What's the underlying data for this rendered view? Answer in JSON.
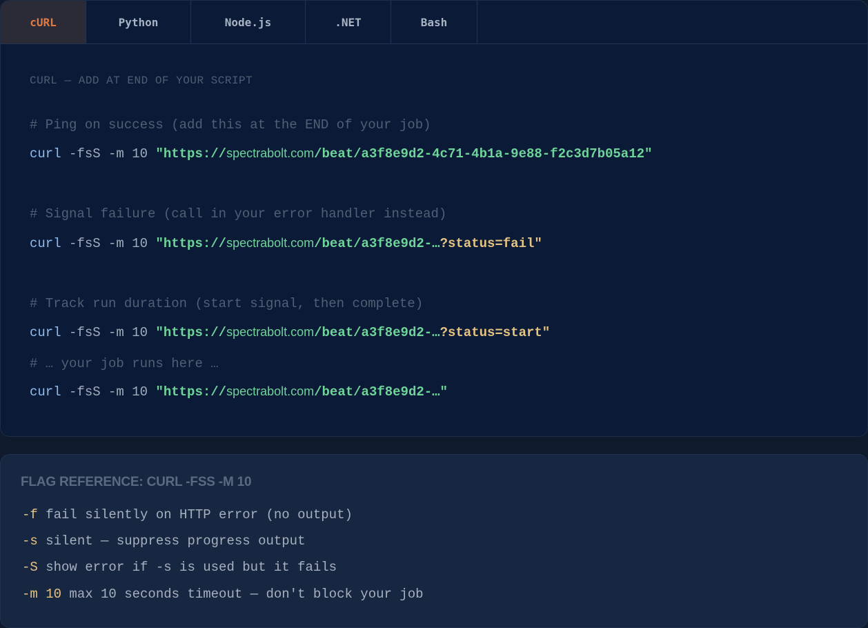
{
  "tabs": [
    {
      "label": "cURL",
      "active": true
    },
    {
      "label": "Python",
      "active": false
    },
    {
      "label": "Node.js",
      "active": false
    },
    {
      "label": ".NET",
      "active": false
    },
    {
      "label": "Bash",
      "active": false
    }
  ],
  "code": {
    "caption": "CURL — ADD AT END OF YOUR SCRIPT",
    "comment_success": "# Ping on success (add this at the END of your job)",
    "comment_fail": "# Signal failure (call in your error handler instead)",
    "comment_duration": "# Track run duration (start signal, then complete)",
    "comment_job": "# … your job runs here …",
    "cmd": "curl",
    "opts": " -fsS -m 10 ",
    "scheme": "\"https://",
    "host": "spectrabolt.com",
    "path_full": "/beat/a3f8e9d2-4c71-4b1a-9e88-f2c3d7b05a12\"",
    "path_short": "/beat/a3f8e9d2-…",
    "qs_fail": "?status=fail\"",
    "qs_start": "?status=start\"",
    "path_end": "/beat/a3f8e9d2-…\""
  },
  "reference": {
    "title": "FLAG REFERENCE: CURL -FSS -M 10",
    "items": [
      {
        "flag": "-f",
        "text": " fail silently on HTTP error (no output)"
      },
      {
        "flag": "-s",
        "text": " silent — suppress progress output"
      },
      {
        "flag": "-S",
        "text": " show error if -s is used but it fails"
      },
      {
        "flag": "-m 10",
        "text": " max 10 seconds timeout — don't block your job"
      }
    ]
  },
  "colors": {
    "active_tab_text": "#e07a45",
    "string": "#6fd49a",
    "query": "#e5c383",
    "keyword": "#8fbdf0"
  }
}
